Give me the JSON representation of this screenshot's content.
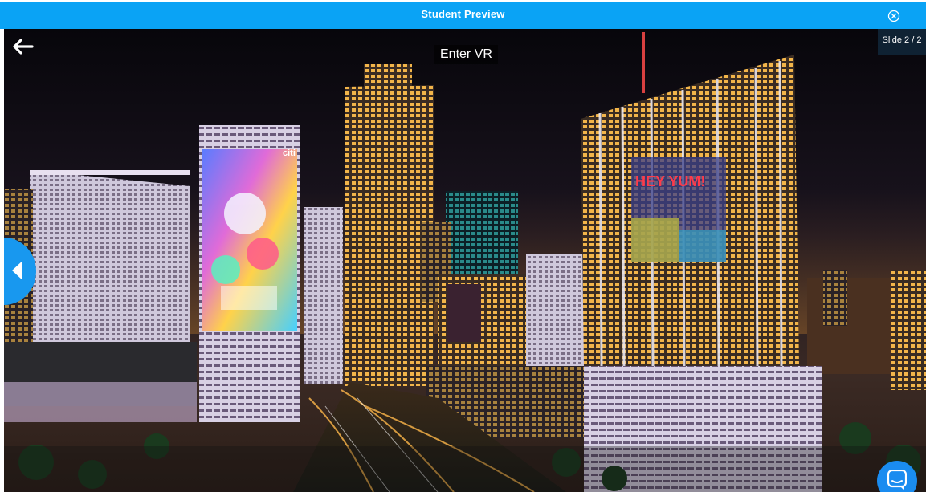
{
  "header": {
    "title": "Student Preview",
    "close_icon": "close-circle-icon"
  },
  "viewer": {
    "enter_vr_label": "Enter VR",
    "slide_counter": "Slide 2 / 2",
    "back_icon": "arrow-left-icon",
    "prev_icon": "chevron-left-icon",
    "chat_icon": "chat-bubble-icon",
    "scene_signs": [
      "citi",
      "HEY YUM!"
    ]
  },
  "colors": {
    "header_blue": "#0aa3f5",
    "nav_blue": "#1898ef",
    "chat_blue": "#1a8cf0",
    "counter_bg": "#0f2233"
  }
}
